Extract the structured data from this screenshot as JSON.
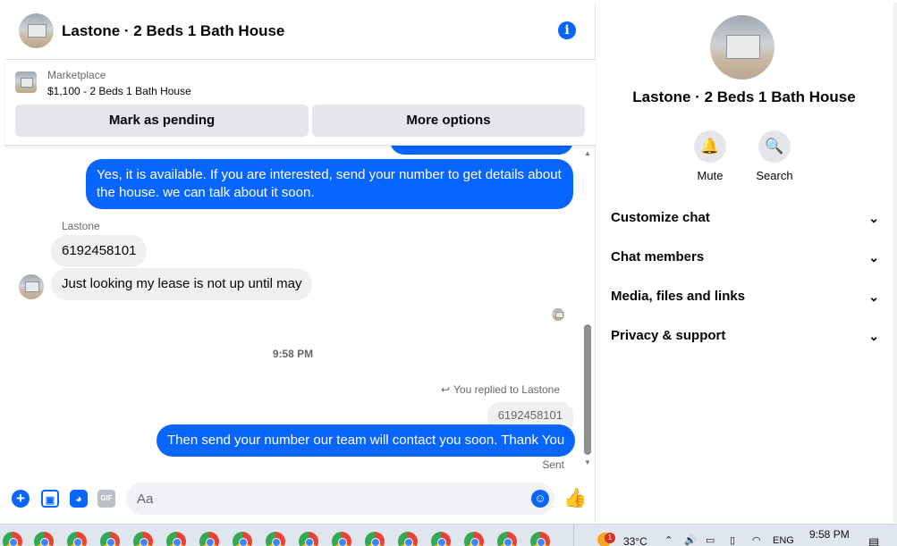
{
  "header": {
    "title": "Lastone · 2 Beds 1 Bath House",
    "info_icon": "i"
  },
  "marketplace": {
    "label": "Marketplace",
    "price_title": "$1,100 - 2 Beds 1 Bath House",
    "mark_pending": "Mark as pending",
    "more_options": "More options"
  },
  "messages": {
    "outgoing_1": "Yes, it is available. If you are interested, send your number to get details about the house. we can talk about it soon.",
    "sender_name": "Lastone",
    "incoming_1": "6192458101",
    "incoming_2": "Just looking my lease is not up until may",
    "time_separator": "9:58 PM",
    "reply_note": "You replied to Lastone",
    "quoted": "6192458101",
    "outgoing_2": "Then send your number our team will contact you soon. Thank You",
    "status": "Sent"
  },
  "composer": {
    "placeholder": "Aa",
    "gif_label": "GIF"
  },
  "info_panel": {
    "title": "Lastone · 2 Beds 1 Bath House",
    "mute": "Mute",
    "search": "Search",
    "rows": [
      "Customize chat",
      "Chat members",
      "Media, files and links",
      "Privacy & support"
    ]
  },
  "taskbar": {
    "temperature": "33°C",
    "notification_count": "1",
    "language": "ENG",
    "time": "9:58 PM"
  },
  "colors": {
    "accent": "#0866ff",
    "bubble_in": "#f0f0f0"
  }
}
